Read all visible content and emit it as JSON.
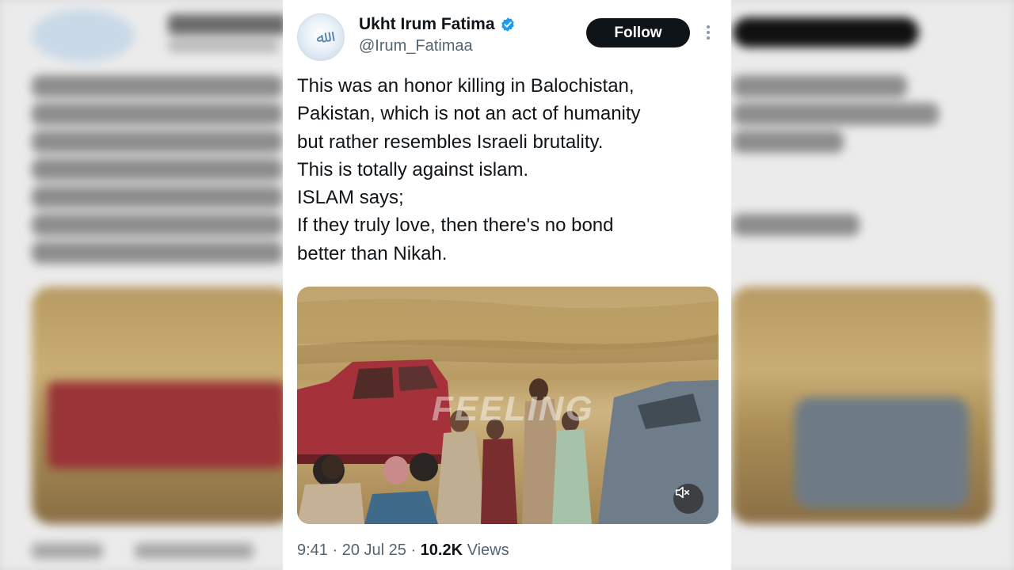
{
  "author": {
    "display_name": "Ukht Irum Fatima",
    "handle": "@Irum_Fatimaa",
    "verified": true,
    "avatar_icon": "calligraphy-avatar-icon"
  },
  "actions": {
    "follow_label": "Follow",
    "more_icon": "more-dots-icon"
  },
  "tweet": {
    "lines": [
      "This was an honor killing in Balochistan,",
      "Pakistan, which is not an act of humanity",
      "but rather resembles Israeli brutality.",
      "This is totally against islam.",
      "ISLAM says;",
      "If they truly love, then there's no bond",
      "better than Nikah."
    ]
  },
  "media": {
    "watermark": "FEELING",
    "mute_icon": "speaker-muted-icon"
  },
  "meta": {
    "time": "9:41",
    "date": "20 Jul 25",
    "views_count": "10.2K",
    "views_label": "Views"
  },
  "colors": {
    "text": "#0f1419",
    "secondary": "#536471",
    "verified": "#1d9bf0",
    "follow_bg": "#0f1419"
  }
}
